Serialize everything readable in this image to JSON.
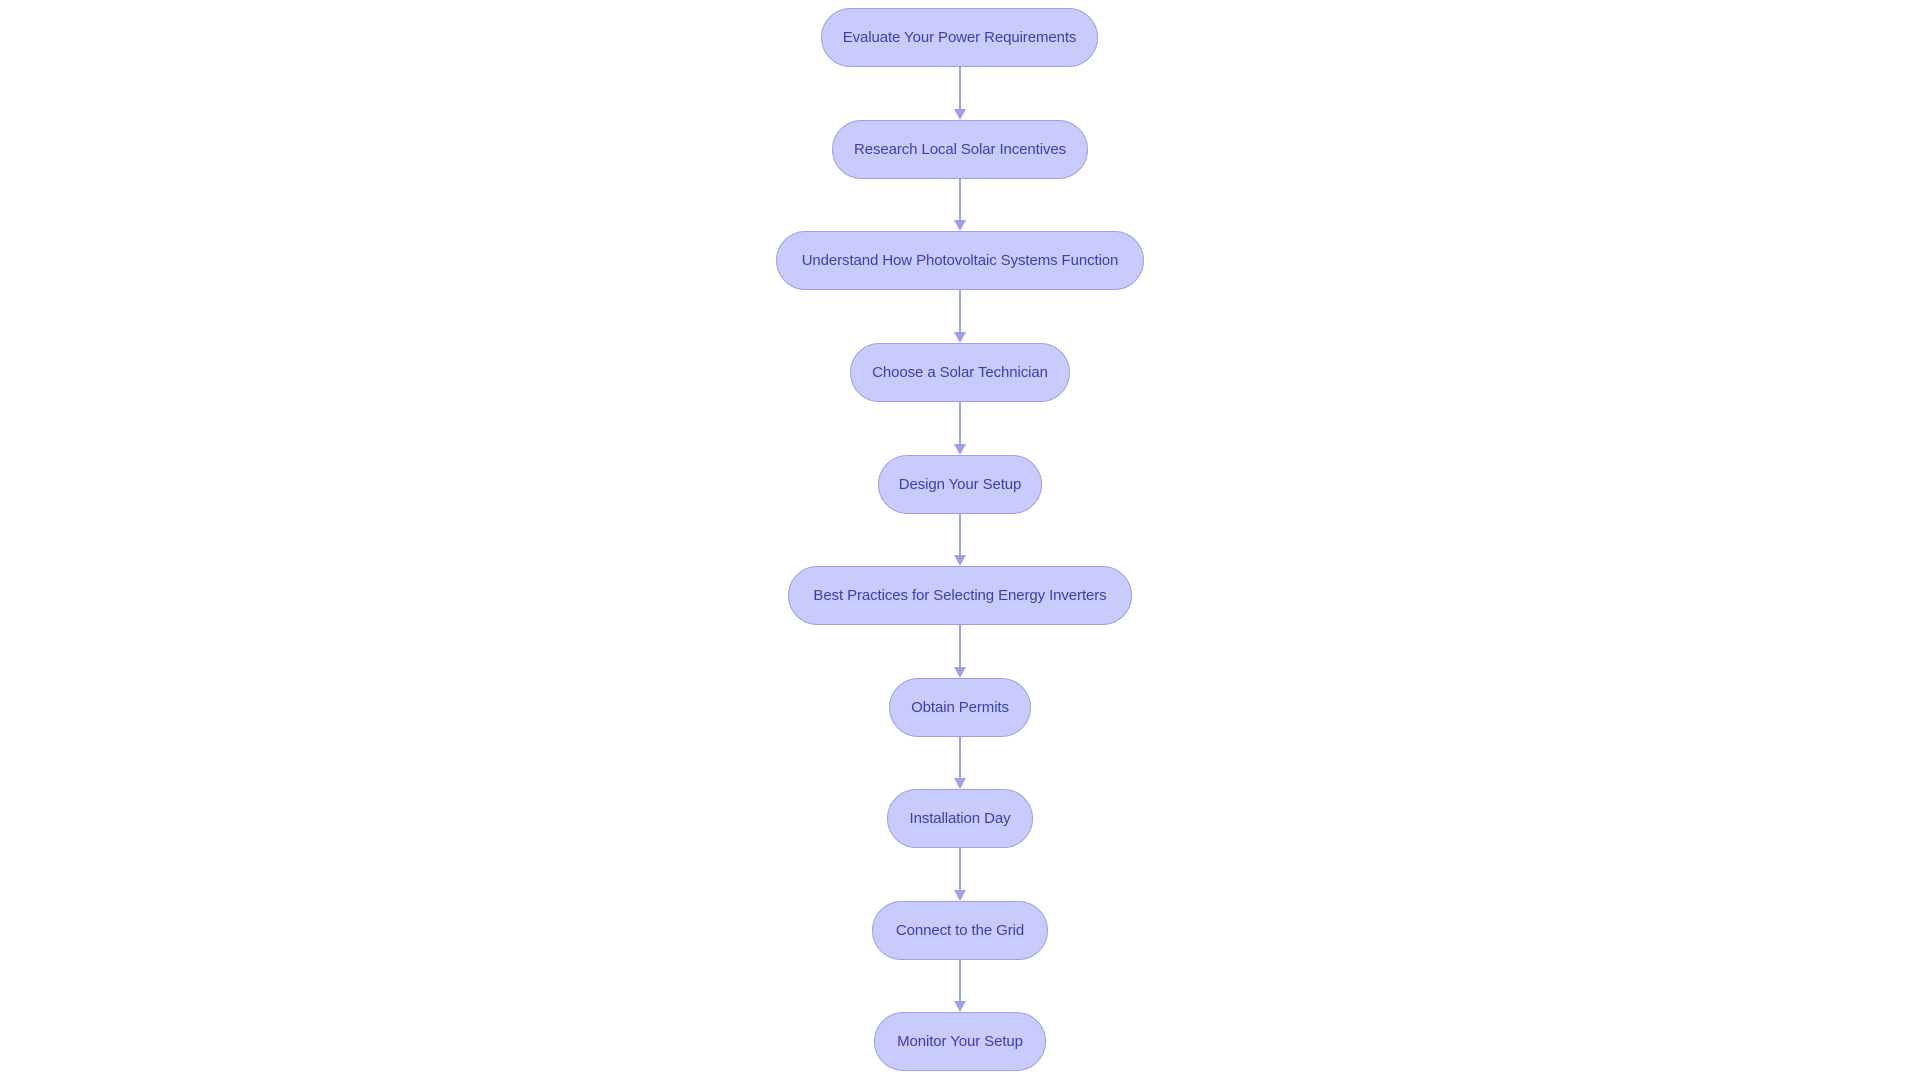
{
  "diagram": {
    "type": "flowchart",
    "direction": "top-to-bottom",
    "colors": {
      "node_fill": "#C8CBFB",
      "node_stroke": "#9CA1E6",
      "node_text": "#3B3FAE",
      "edge": "#9EA3E9",
      "background": "#FFFFFF"
    },
    "nodes": [
      {
        "id": "n1",
        "label": "Evaluate Your Power Requirements"
      },
      {
        "id": "n2",
        "label": "Research Local Solar Incentives"
      },
      {
        "id": "n3",
        "label": "Understand How Photovoltaic Systems Function"
      },
      {
        "id": "n4",
        "label": "Choose a Solar Technician"
      },
      {
        "id": "n5",
        "label": "Design Your Setup"
      },
      {
        "id": "n6",
        "label": "Best Practices for Selecting Energy Inverters"
      },
      {
        "id": "n7",
        "label": "Obtain Permits"
      },
      {
        "id": "n8",
        "label": "Installation Day"
      },
      {
        "id": "n9",
        "label": "Connect to the Grid"
      },
      {
        "id": "n10",
        "label": "Monitor Your Setup"
      }
    ],
    "edges": [
      {
        "from": "n1",
        "to": "n2"
      },
      {
        "from": "n2",
        "to": "n3"
      },
      {
        "from": "n3",
        "to": "n4"
      },
      {
        "from": "n4",
        "to": "n5"
      },
      {
        "from": "n5",
        "to": "n6"
      },
      {
        "from": "n6",
        "to": "n7"
      },
      {
        "from": "n7",
        "to": "n8"
      },
      {
        "from": "n8",
        "to": "n9"
      },
      {
        "from": "n9",
        "to": "n10"
      }
    ]
  }
}
